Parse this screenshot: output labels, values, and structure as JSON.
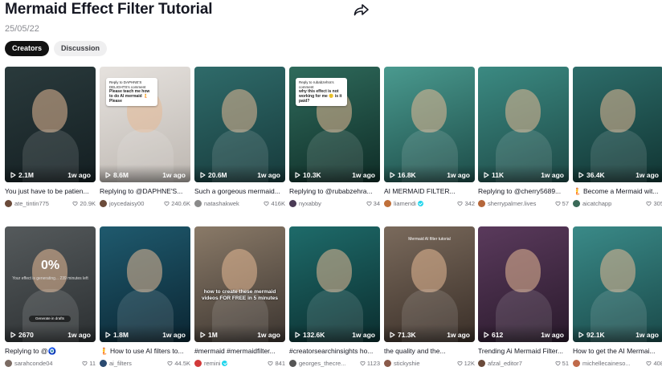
{
  "page": {
    "title": "Mermaid Effect Filter Tutorial",
    "date": "25/05/22",
    "share_icon": "share-arrow-icon"
  },
  "tabs": [
    {
      "label": "Creators",
      "active": true
    },
    {
      "label": "Discussion",
      "active": false
    }
  ],
  "videos": [
    {
      "views": "2.1M",
      "age": "1w ago",
      "caption": "You just have to be patien...",
      "user": "ate_tintin775",
      "likes": "20.9K",
      "verified": false,
      "bg": [
        "#2a3a3c",
        "#141f22"
      ],
      "avatar": "#6b4b3a"
    },
    {
      "views": "8.6M",
      "age": "1w ago",
      "caption": "Replying to @DAPHNE'S...",
      "user": "joycedaisy00",
      "likes": "240.6K",
      "verified": false,
      "bg": [
        "#e6e2de",
        "#bdb7b1"
      ],
      "avatar": "#6b4b3a",
      "bubble": {
        "head": "Reply to DAPHNE'S DELIGHTS's comment",
        "body": "Please teach me how to do AI mermaid 🧜 Please"
      }
    },
    {
      "views": "20.6M",
      "age": "1w ago",
      "caption": "Such a gorgeous mermaid...",
      "user": "natashakwek",
      "likes": "416K",
      "verified": false,
      "bg": [
        "#2f6b6a",
        "#173b3c"
      ],
      "avatar": "#8a8a8a"
    },
    {
      "views": "10.3K",
      "age": "1w ago",
      "caption": "Replying to @rubabzehra...",
      "user": "nyxabby",
      "likes": "34",
      "verified": false,
      "bg": [
        "#2f6b5c",
        "#0f2d27"
      ],
      "avatar": "#4a3a55",
      "bubble": {
        "head": "Reply to rubabzehra's comment",
        "body": "why this effect is not working for me 🙁 is it paid?"
      }
    },
    {
      "views": "16.8K",
      "age": "1w ago",
      "caption": "AI MERMAID FILTER...",
      "user": "liamendi",
      "likes": "342",
      "verified": true,
      "bg": [
        "#4a9a8f",
        "#1d4d49"
      ],
      "avatar": "#c0703a"
    },
    {
      "views": "11K",
      "age": "1w ago",
      "caption": "Replying to @cherry5689...",
      "user": "sherrypalmer.lives",
      "likes": "57",
      "verified": false,
      "bg": [
        "#3b8a82",
        "#1e4a47"
      ],
      "avatar": "#b5673b"
    },
    {
      "views": "36.4K",
      "age": "1w ago",
      "caption": "🧜 Become a Mermaid wit...",
      "user": "aicatchapp",
      "likes": "305",
      "verified": false,
      "bg": [
        "#2d6d6a",
        "#113533"
      ],
      "avatar": "#3a6a58"
    },
    {
      "views": "2670",
      "age": "1w ago",
      "caption": "Replying to @🧿",
      "user": "sarahconde04",
      "likes": "11",
      "verified": false,
      "bg": [
        "#555a5c",
        "#2c3032"
      ],
      "avatar": "#7b6b63",
      "percent": "0%",
      "generating": "Your effect is generating... 239 minutes left",
      "draft": "Generate in drafts"
    },
    {
      "views": "1.8M",
      "age": "1w ago",
      "caption": "🧜 How to use AI filters to...",
      "user": "ai_filters",
      "likes": "44.5K",
      "verified": false,
      "bg": [
        "#1f5a6e",
        "#0b2633"
      ],
      "avatar": "#2a4a70"
    },
    {
      "views": "1M",
      "age": "1w ago",
      "caption": "#mermaid #mermaidfilter...",
      "user": "remini",
      "likes": "841",
      "verified": true,
      "bg": [
        "#8a7a68",
        "#3c3530"
      ],
      "avatar": "#d23a3a",
      "overlay": "how to create these mermaid videos FOR FREE in 5 minutes"
    },
    {
      "views": "132.6K",
      "age": "1w ago",
      "caption": "#creatorsearchinsights ho...",
      "user": "georges_thecre...",
      "likes": "1123",
      "verified": false,
      "bg": [
        "#1e6b6a",
        "#0b2e2f"
      ],
      "avatar": "#555"
    },
    {
      "views": "71.3K",
      "age": "1w ago",
      "caption": "the quality and the...",
      "user": "stickyshie",
      "likes": "12K",
      "verified": false,
      "bg": [
        "#7a6a5c",
        "#3a2f28"
      ],
      "avatar": "#8a5a4a",
      "topText": "Mermaid AI filter tutorial"
    },
    {
      "views": "612",
      "age": "1w ago",
      "caption": "Trending Ai Mermaid Filter...",
      "user": "afzal_editor7",
      "likes": "51",
      "verified": false,
      "bg": [
        "#5a3a5c",
        "#2a1a2c"
      ],
      "avatar": "#6a4a3a"
    },
    {
      "views": "92.1K",
      "age": "1w ago",
      "caption": "How to get the AI Mermai...",
      "user": "michellecaineso...",
      "likes": "408",
      "verified": false,
      "bg": [
        "#3a8a88",
        "#1a4a4a"
      ],
      "avatar": "#c06a4a"
    }
  ]
}
